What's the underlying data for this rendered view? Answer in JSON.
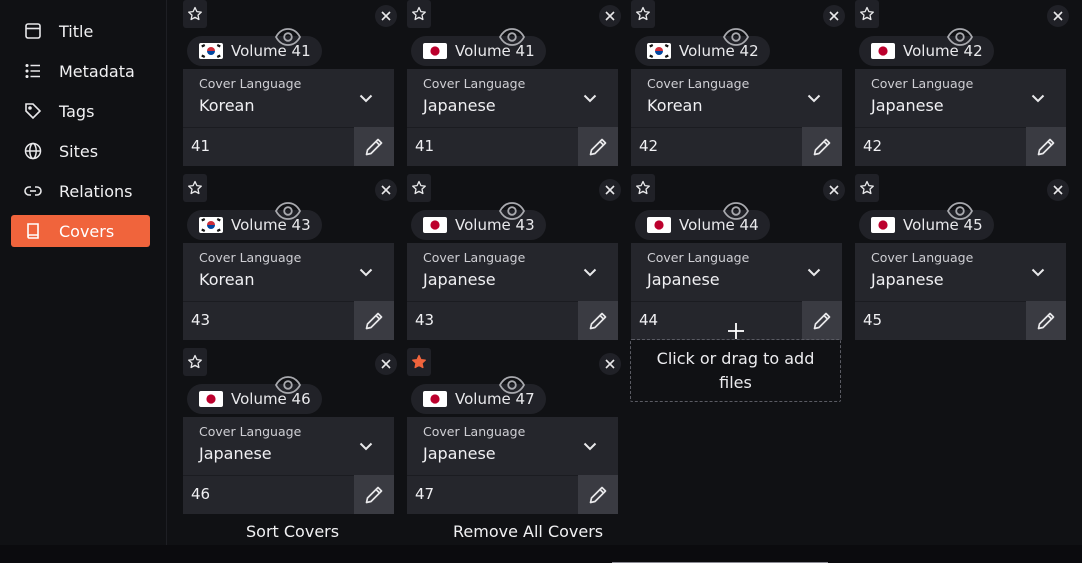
{
  "sidebar": {
    "items": [
      {
        "label": "Title",
        "icon": "title-icon"
      },
      {
        "label": "Metadata",
        "icon": "list-icon"
      },
      {
        "label": "Tags",
        "icon": "tag-icon"
      },
      {
        "label": "Sites",
        "icon": "globe-icon"
      },
      {
        "label": "Relations",
        "icon": "link-icon"
      },
      {
        "label": "Covers",
        "icon": "book-icon",
        "active": true
      }
    ]
  },
  "covers": [
    {
      "volume_label": "Volume 41",
      "flag": "south-korea-flag",
      "language_caption": "Cover Language",
      "language": "Korean",
      "volume_number": "41",
      "starred": false
    },
    {
      "volume_label": "Volume 41",
      "flag": "japan-flag",
      "language_caption": "Cover Language",
      "language": "Japanese",
      "volume_number": "41",
      "starred": false
    },
    {
      "volume_label": "Volume 42",
      "flag": "south-korea-flag",
      "language_caption": "Cover Language",
      "language": "Korean",
      "volume_number": "42",
      "starred": false
    },
    {
      "volume_label": "Volume 42",
      "flag": "japan-flag",
      "language_caption": "Cover Language",
      "language": "Japanese",
      "volume_number": "42",
      "starred": false
    },
    {
      "volume_label": "Volume 43",
      "flag": "south-korea-flag",
      "language_caption": "Cover Language",
      "language": "Korean",
      "volume_number": "43",
      "starred": false
    },
    {
      "volume_label": "Volume 43",
      "flag": "japan-flag",
      "language_caption": "Cover Language",
      "language": "Japanese",
      "volume_number": "43",
      "starred": false
    },
    {
      "volume_label": "Volume 44",
      "flag": "japan-flag",
      "language_caption": "Cover Language",
      "language": "Japanese",
      "volume_number": "44",
      "starred": false
    },
    {
      "volume_label": "Volume 45",
      "flag": "japan-flag",
      "language_caption": "Cover Language",
      "language": "Japanese",
      "volume_number": "45",
      "starred": false
    },
    {
      "volume_label": "Volume 46",
      "flag": "japan-flag",
      "language_caption": "Cover Language",
      "language": "Japanese",
      "volume_number": "46",
      "starred": false
    },
    {
      "volume_label": "Volume 47",
      "flag": "japan-flag",
      "language_caption": "Cover Language",
      "language": "Japanese",
      "volume_number": "47",
      "starred": true
    }
  ],
  "dropzone": {
    "label": "Click or drag to add files",
    "icon": "plus-icon"
  },
  "actions": {
    "sort_label": "Sort Covers",
    "remove_all_label": "Remove All Covers"
  },
  "colors": {
    "accent": "#f0643c",
    "card_bg": "#25262c",
    "page_bg": "#101114",
    "star_active": "#f0643c"
  }
}
